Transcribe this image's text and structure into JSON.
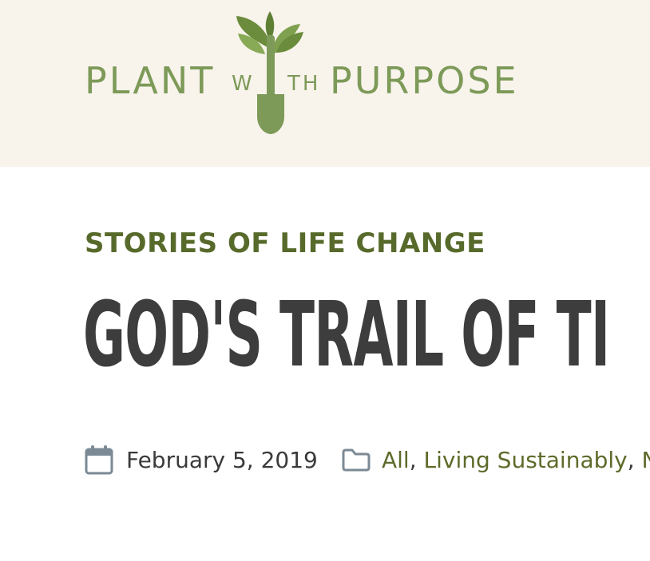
{
  "logo": {
    "text_plant": "PLANT",
    "text_w": "W",
    "text_th": "TH",
    "text_purpose": "PURPOSE",
    "icon": "sapling-shovel-icon",
    "color": "#7d9a58"
  },
  "article": {
    "category": "STORIES OF LIFE CHANGE",
    "title": "GOD'S TRAIL OF TI",
    "date": "February 5, 2019",
    "categories": [
      "All",
      "Living Sustainably",
      "N"
    ],
    "separator": ","
  },
  "icons": {
    "date": "calendar-icon",
    "categories": "folder-icon"
  },
  "colors": {
    "header_bg": "#f8f4ec",
    "accent_green": "#586a2b",
    "link_green": "#5d6b2a",
    "title_gray": "#3d3d3d",
    "icon_gray": "#7b8a94"
  }
}
